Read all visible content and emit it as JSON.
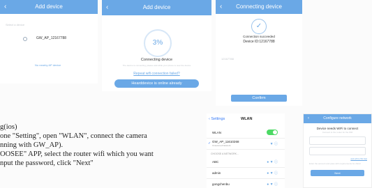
{
  "screen1": {
    "title": "Add device",
    "hint": "Select a device",
    "network": "GW_AP_12167788",
    "link": "No nearby AP device"
  },
  "screen2": {
    "title": "Add device",
    "percent": "3%",
    "status": "Connecting device",
    "desc": "The device is connecting, please wait while your phone is near the device",
    "link": "Repeat wifi connection failed?",
    "button": "Hearddevice is online already"
  },
  "screen3": {
    "title": "Connecting device",
    "success": "Connection succeeded",
    "device_id": "Device ID:12167788",
    "id_label": "12167788",
    "button": "Confirm"
  },
  "screen4": {
    "back": "Settings",
    "title": "WLAN",
    "wlan_label": "WLAN",
    "connected": "GW_AP_11610268",
    "connected_sub": "Unsecured Network",
    "section": "CHOOSE A NETWORK...",
    "networks": [
      "ABC",
      "admin",
      "gongchenbu"
    ]
  },
  "screen5": {
    "title": "Configure network",
    "heading": "Device needs WiFi to connect",
    "subheading": "Connect to the router for the Wifi",
    "small_link": "and wifi is 5G fast",
    "note": "Enter the account and pass with requirements for 2GHz",
    "button": "Next"
  },
  "instructions": {
    "line1": "g(ios)",
    "line2": "one \"Setting\", open \"WLAN\", connect the camera",
    "line3": "nning with GW_AP).",
    "line4": "OOSEE\" APP, select the router wifi which you want",
    "line5": "nput the password, click \"Next\""
  },
  "colors": {
    "accent": "#6aa8e6",
    "toggle": "#4cd964"
  }
}
